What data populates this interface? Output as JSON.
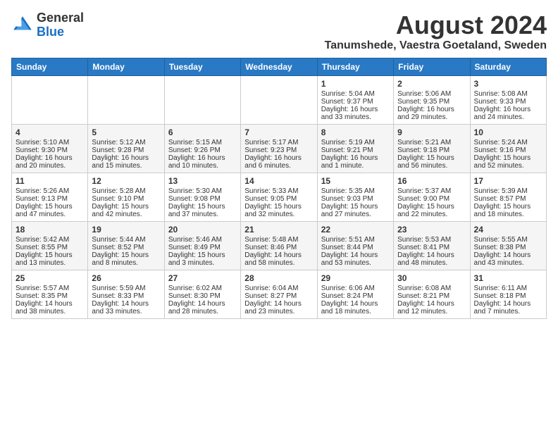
{
  "header": {
    "logo_line1": "General",
    "logo_line2": "Blue",
    "title": "August 2024",
    "subtitle": "Tanumshede, Vaestra Goetaland, Sweden"
  },
  "weekdays": [
    "Sunday",
    "Monday",
    "Tuesday",
    "Wednesday",
    "Thursday",
    "Friday",
    "Saturday"
  ],
  "weeks": [
    [
      {
        "day": "",
        "text": ""
      },
      {
        "day": "",
        "text": ""
      },
      {
        "day": "",
        "text": ""
      },
      {
        "day": "",
        "text": ""
      },
      {
        "day": "1",
        "text": "Sunrise: 5:04 AM\nSunset: 9:37 PM\nDaylight: 16 hours\nand 33 minutes."
      },
      {
        "day": "2",
        "text": "Sunrise: 5:06 AM\nSunset: 9:35 PM\nDaylight: 16 hours\nand 29 minutes."
      },
      {
        "day": "3",
        "text": "Sunrise: 5:08 AM\nSunset: 9:33 PM\nDaylight: 16 hours\nand 24 minutes."
      }
    ],
    [
      {
        "day": "4",
        "text": "Sunrise: 5:10 AM\nSunset: 9:30 PM\nDaylight: 16 hours\nand 20 minutes."
      },
      {
        "day": "5",
        "text": "Sunrise: 5:12 AM\nSunset: 9:28 PM\nDaylight: 16 hours\nand 15 minutes."
      },
      {
        "day": "6",
        "text": "Sunrise: 5:15 AM\nSunset: 9:26 PM\nDaylight: 16 hours\nand 10 minutes."
      },
      {
        "day": "7",
        "text": "Sunrise: 5:17 AM\nSunset: 9:23 PM\nDaylight: 16 hours\nand 6 minutes."
      },
      {
        "day": "8",
        "text": "Sunrise: 5:19 AM\nSunset: 9:21 PM\nDaylight: 16 hours\nand 1 minute."
      },
      {
        "day": "9",
        "text": "Sunrise: 5:21 AM\nSunset: 9:18 PM\nDaylight: 15 hours\nand 56 minutes."
      },
      {
        "day": "10",
        "text": "Sunrise: 5:24 AM\nSunset: 9:16 PM\nDaylight: 15 hours\nand 52 minutes."
      }
    ],
    [
      {
        "day": "11",
        "text": "Sunrise: 5:26 AM\nSunset: 9:13 PM\nDaylight: 15 hours\nand 47 minutes."
      },
      {
        "day": "12",
        "text": "Sunrise: 5:28 AM\nSunset: 9:10 PM\nDaylight: 15 hours\nand 42 minutes."
      },
      {
        "day": "13",
        "text": "Sunrise: 5:30 AM\nSunset: 9:08 PM\nDaylight: 15 hours\nand 37 minutes."
      },
      {
        "day": "14",
        "text": "Sunrise: 5:33 AM\nSunset: 9:05 PM\nDaylight: 15 hours\nand 32 minutes."
      },
      {
        "day": "15",
        "text": "Sunrise: 5:35 AM\nSunset: 9:03 PM\nDaylight: 15 hours\nand 27 minutes."
      },
      {
        "day": "16",
        "text": "Sunrise: 5:37 AM\nSunset: 9:00 PM\nDaylight: 15 hours\nand 22 minutes."
      },
      {
        "day": "17",
        "text": "Sunrise: 5:39 AM\nSunset: 8:57 PM\nDaylight: 15 hours\nand 18 minutes."
      }
    ],
    [
      {
        "day": "18",
        "text": "Sunrise: 5:42 AM\nSunset: 8:55 PM\nDaylight: 15 hours\nand 13 minutes."
      },
      {
        "day": "19",
        "text": "Sunrise: 5:44 AM\nSunset: 8:52 PM\nDaylight: 15 hours\nand 8 minutes."
      },
      {
        "day": "20",
        "text": "Sunrise: 5:46 AM\nSunset: 8:49 PM\nDaylight: 15 hours\nand 3 minutes."
      },
      {
        "day": "21",
        "text": "Sunrise: 5:48 AM\nSunset: 8:46 PM\nDaylight: 14 hours\nand 58 minutes."
      },
      {
        "day": "22",
        "text": "Sunrise: 5:51 AM\nSunset: 8:44 PM\nDaylight: 14 hours\nand 53 minutes."
      },
      {
        "day": "23",
        "text": "Sunrise: 5:53 AM\nSunset: 8:41 PM\nDaylight: 14 hours\nand 48 minutes."
      },
      {
        "day": "24",
        "text": "Sunrise: 5:55 AM\nSunset: 8:38 PM\nDaylight: 14 hours\nand 43 minutes."
      }
    ],
    [
      {
        "day": "25",
        "text": "Sunrise: 5:57 AM\nSunset: 8:35 PM\nDaylight: 14 hours\nand 38 minutes."
      },
      {
        "day": "26",
        "text": "Sunrise: 5:59 AM\nSunset: 8:33 PM\nDaylight: 14 hours\nand 33 minutes."
      },
      {
        "day": "27",
        "text": "Sunrise: 6:02 AM\nSunset: 8:30 PM\nDaylight: 14 hours\nand 28 minutes."
      },
      {
        "day": "28",
        "text": "Sunrise: 6:04 AM\nSunset: 8:27 PM\nDaylight: 14 hours\nand 23 minutes."
      },
      {
        "day": "29",
        "text": "Sunrise: 6:06 AM\nSunset: 8:24 PM\nDaylight: 14 hours\nand 18 minutes."
      },
      {
        "day": "30",
        "text": "Sunrise: 6:08 AM\nSunset: 8:21 PM\nDaylight: 14 hours\nand 12 minutes."
      },
      {
        "day": "31",
        "text": "Sunrise: 6:11 AM\nSunset: 8:18 PM\nDaylight: 14 hours\nand 7 minutes."
      }
    ]
  ]
}
